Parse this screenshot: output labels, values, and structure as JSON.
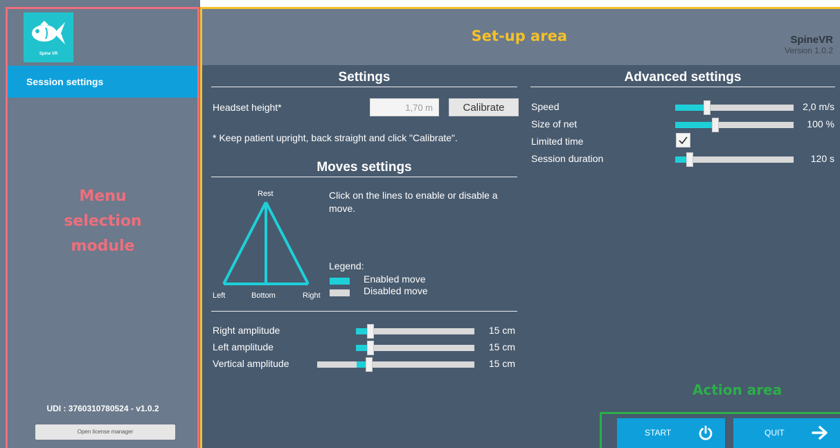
{
  "sidebar": {
    "logo_caption": "Spine VR",
    "menu_item": "Session settings",
    "overlay_lines": [
      "Menu",
      "selection",
      "module"
    ],
    "udi": "UDI : 3760310780524 - v1.0.2",
    "license_button": "Open license manager"
  },
  "header": {
    "area_label": "Set-up area",
    "app_name": "SpineVR",
    "version": "Version 1.0.2"
  },
  "settings": {
    "title": "Settings",
    "headset_label": "Headset height*",
    "headset_value": "1,70 m",
    "calibrate_button": "Calibrate",
    "note": "* Keep patient upright, back straight and click \"Calibrate\"."
  },
  "moves": {
    "title": "Moves settings",
    "triangle_labels": {
      "top": "Rest",
      "left": "Left",
      "bottom": "Bottom",
      "right": "Right"
    },
    "instruction_line1": "Click on the lines to enable or disable a",
    "instruction_line2": "move.",
    "legend_title": "Legend:",
    "legend_enabled": "Enabled move",
    "legend_disabled": "Disabled move",
    "colors": {
      "enabled": "#1ecfd8",
      "disabled": "#d9d9d9"
    },
    "amplitudes": [
      {
        "label": "Right amplitude",
        "value": "15 cm",
        "level": 0.12
      },
      {
        "label": "Left amplitude",
        "value": "15 cm",
        "level": 0.12
      },
      {
        "label": "Vertical amplitude",
        "value": "15 cm",
        "level": 0.33
      }
    ]
  },
  "advanced": {
    "title": "Advanced settings",
    "speed": {
      "label": "Speed",
      "value": "2,0 m/s",
      "level": 0.27
    },
    "net": {
      "label": "Size of net",
      "value": "100 %",
      "level": 0.34
    },
    "limited_time": {
      "label": "Limited time",
      "checked": true
    },
    "duration": {
      "label": "Session duration",
      "value": "120 s",
      "level": 0.12
    }
  },
  "action": {
    "area_label": "Action area",
    "start_button": "START",
    "quit_button": "QUIT",
    "start_icon": "power-icon",
    "quit_icon": "arrow-right-icon"
  },
  "theme": {
    "accent_blue": "#0fa0dc",
    "teal": "#1ecfd8",
    "panel": "#485a6e",
    "menu_outline": "#ee6f7d",
    "setup_outline": "#f6c02a",
    "action_outline": "#2cae4a"
  }
}
